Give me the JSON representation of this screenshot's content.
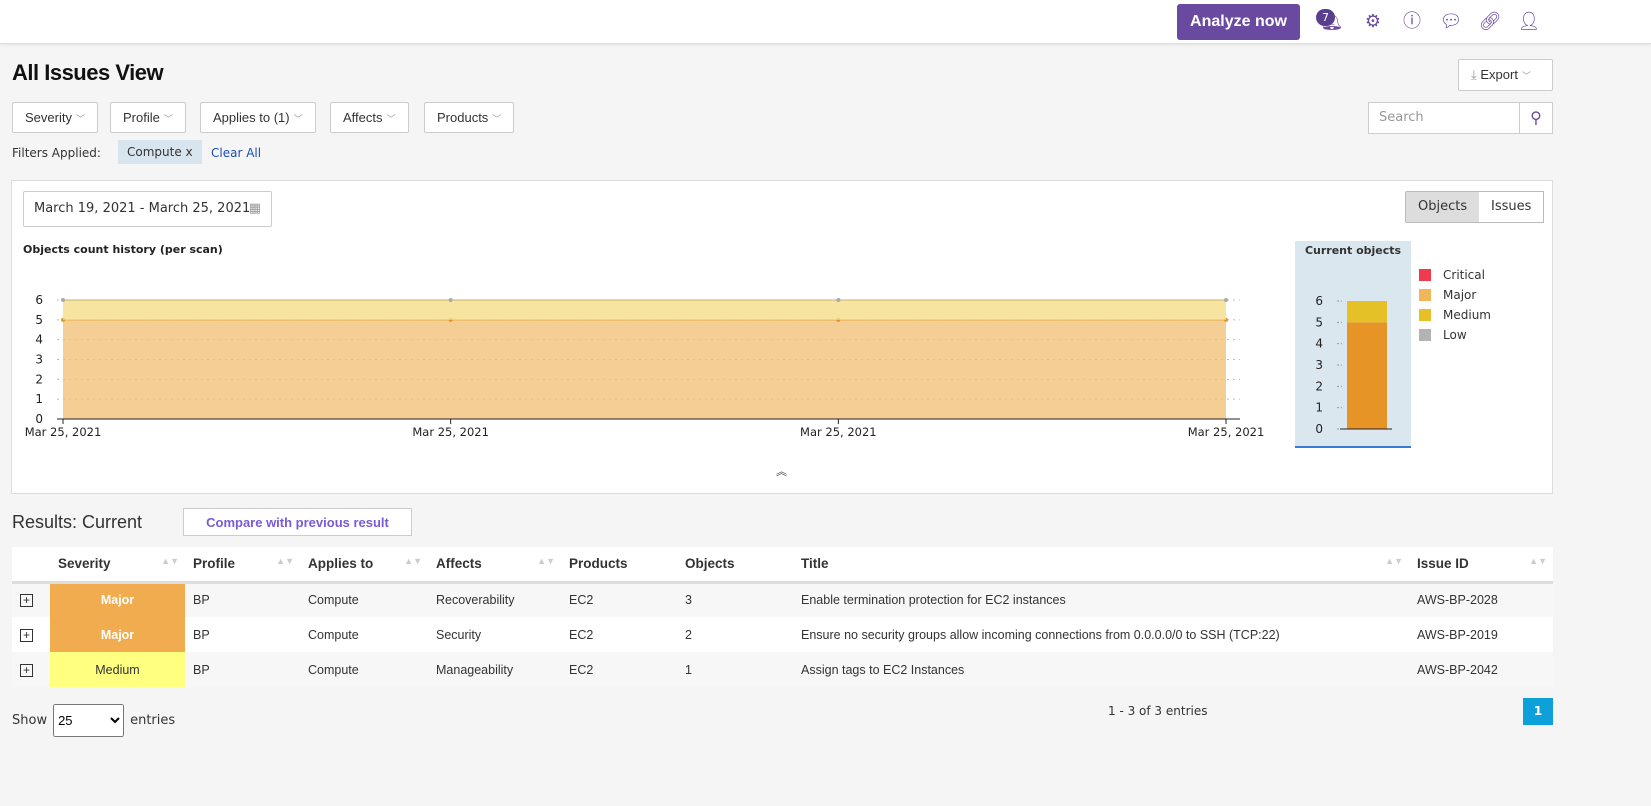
{
  "topbar": {
    "analyze_label": "Analyze now",
    "notification_count": "7"
  },
  "page_title": "All Issues View",
  "export_label": "Export",
  "filters": [
    "Severity",
    "Profile",
    "Applies to (1)",
    "Affects",
    "Products"
  ],
  "search": {
    "placeholder": "Search"
  },
  "filters_applied": {
    "label": "Filters Applied:",
    "chip": "Compute x",
    "clear": "Clear All"
  },
  "date_range": "March 19, 2021 - March 25, 2021",
  "toggle": {
    "objects": "Objects",
    "issues": "Issues",
    "active": "Objects"
  },
  "chart_data": [
    {
      "type": "area",
      "title": "Objects count history (per scan)",
      "x": [
        "Mar 25, 2021",
        "Mar 25, 2021",
        "Mar 25, 2021",
        "Mar 25, 2021"
      ],
      "series": [
        {
          "name": "Major",
          "values": [
            5,
            5,
            5,
            5
          ],
          "color": "#f2c27a"
        },
        {
          "name": "Medium",
          "values": [
            1,
            1,
            1,
            1
          ],
          "color": "#f5dd8a"
        }
      ],
      "stacked": true,
      "ylim": [
        0,
        6
      ],
      "yticks": [
        0,
        1,
        2,
        3,
        4,
        5,
        6
      ],
      "grid": true
    },
    {
      "type": "bar",
      "title": "Current objects",
      "stacked": true,
      "ylim": [
        0,
        6
      ],
      "yticks": [
        0,
        1,
        2,
        3,
        4,
        5,
        6
      ],
      "series": [
        {
          "name": "Critical",
          "values": [
            0
          ],
          "color": "#ef3b4b"
        },
        {
          "name": "Major",
          "values": [
            5
          ],
          "color": "#e59425"
        },
        {
          "name": "Medium",
          "values": [
            1
          ],
          "color": "#e5c027"
        },
        {
          "name": "Low",
          "values": [
            0
          ],
          "color": "#b3b3b3"
        }
      ],
      "legend": [
        "Critical",
        "Major",
        "Medium",
        "Low"
      ],
      "legend_colors": [
        "#ef3b4b",
        "#f0b65a",
        "#e5c027",
        "#b3b3b3"
      ],
      "legend_position": "right"
    }
  ],
  "results": {
    "title": "Results: Current",
    "compare_label": "Compare with previous result"
  },
  "table": {
    "headers": [
      "Severity",
      "Profile",
      "Applies to",
      "Affects",
      "Products",
      "Objects",
      "Title",
      "Issue ID"
    ],
    "rows": [
      {
        "severity": "Major",
        "color": "#f0ac4e",
        "text": "#fff",
        "profile": "BP",
        "applies": "Compute",
        "affects": "Recoverability",
        "products": "EC2",
        "objects": "3",
        "title": "Enable termination protection for EC2 instances",
        "id": "AWS-BP-2028"
      },
      {
        "severity": "Major",
        "color": "#f0ac4e",
        "text": "#fff",
        "profile": "BP",
        "applies": "Compute",
        "affects": "Security",
        "products": "EC2",
        "objects": "2",
        "title": "Ensure no security groups allow incoming connections from 0.0.0.0/0 to SSH (TCP:22)",
        "id": "AWS-BP-2019"
      },
      {
        "severity": "Medium",
        "color": "#ffff80",
        "text": "#333",
        "profile": "BP",
        "applies": "Compute",
        "affects": "Manageability",
        "products": "EC2",
        "objects": "1",
        "title": "Assign tags to EC2 Instances",
        "id": "AWS-BP-2042"
      }
    ]
  },
  "pagination": {
    "show": "Show",
    "entries_value": "25",
    "entries": "entries",
    "info": "1 - 3 of 3 entries",
    "page": "1"
  }
}
